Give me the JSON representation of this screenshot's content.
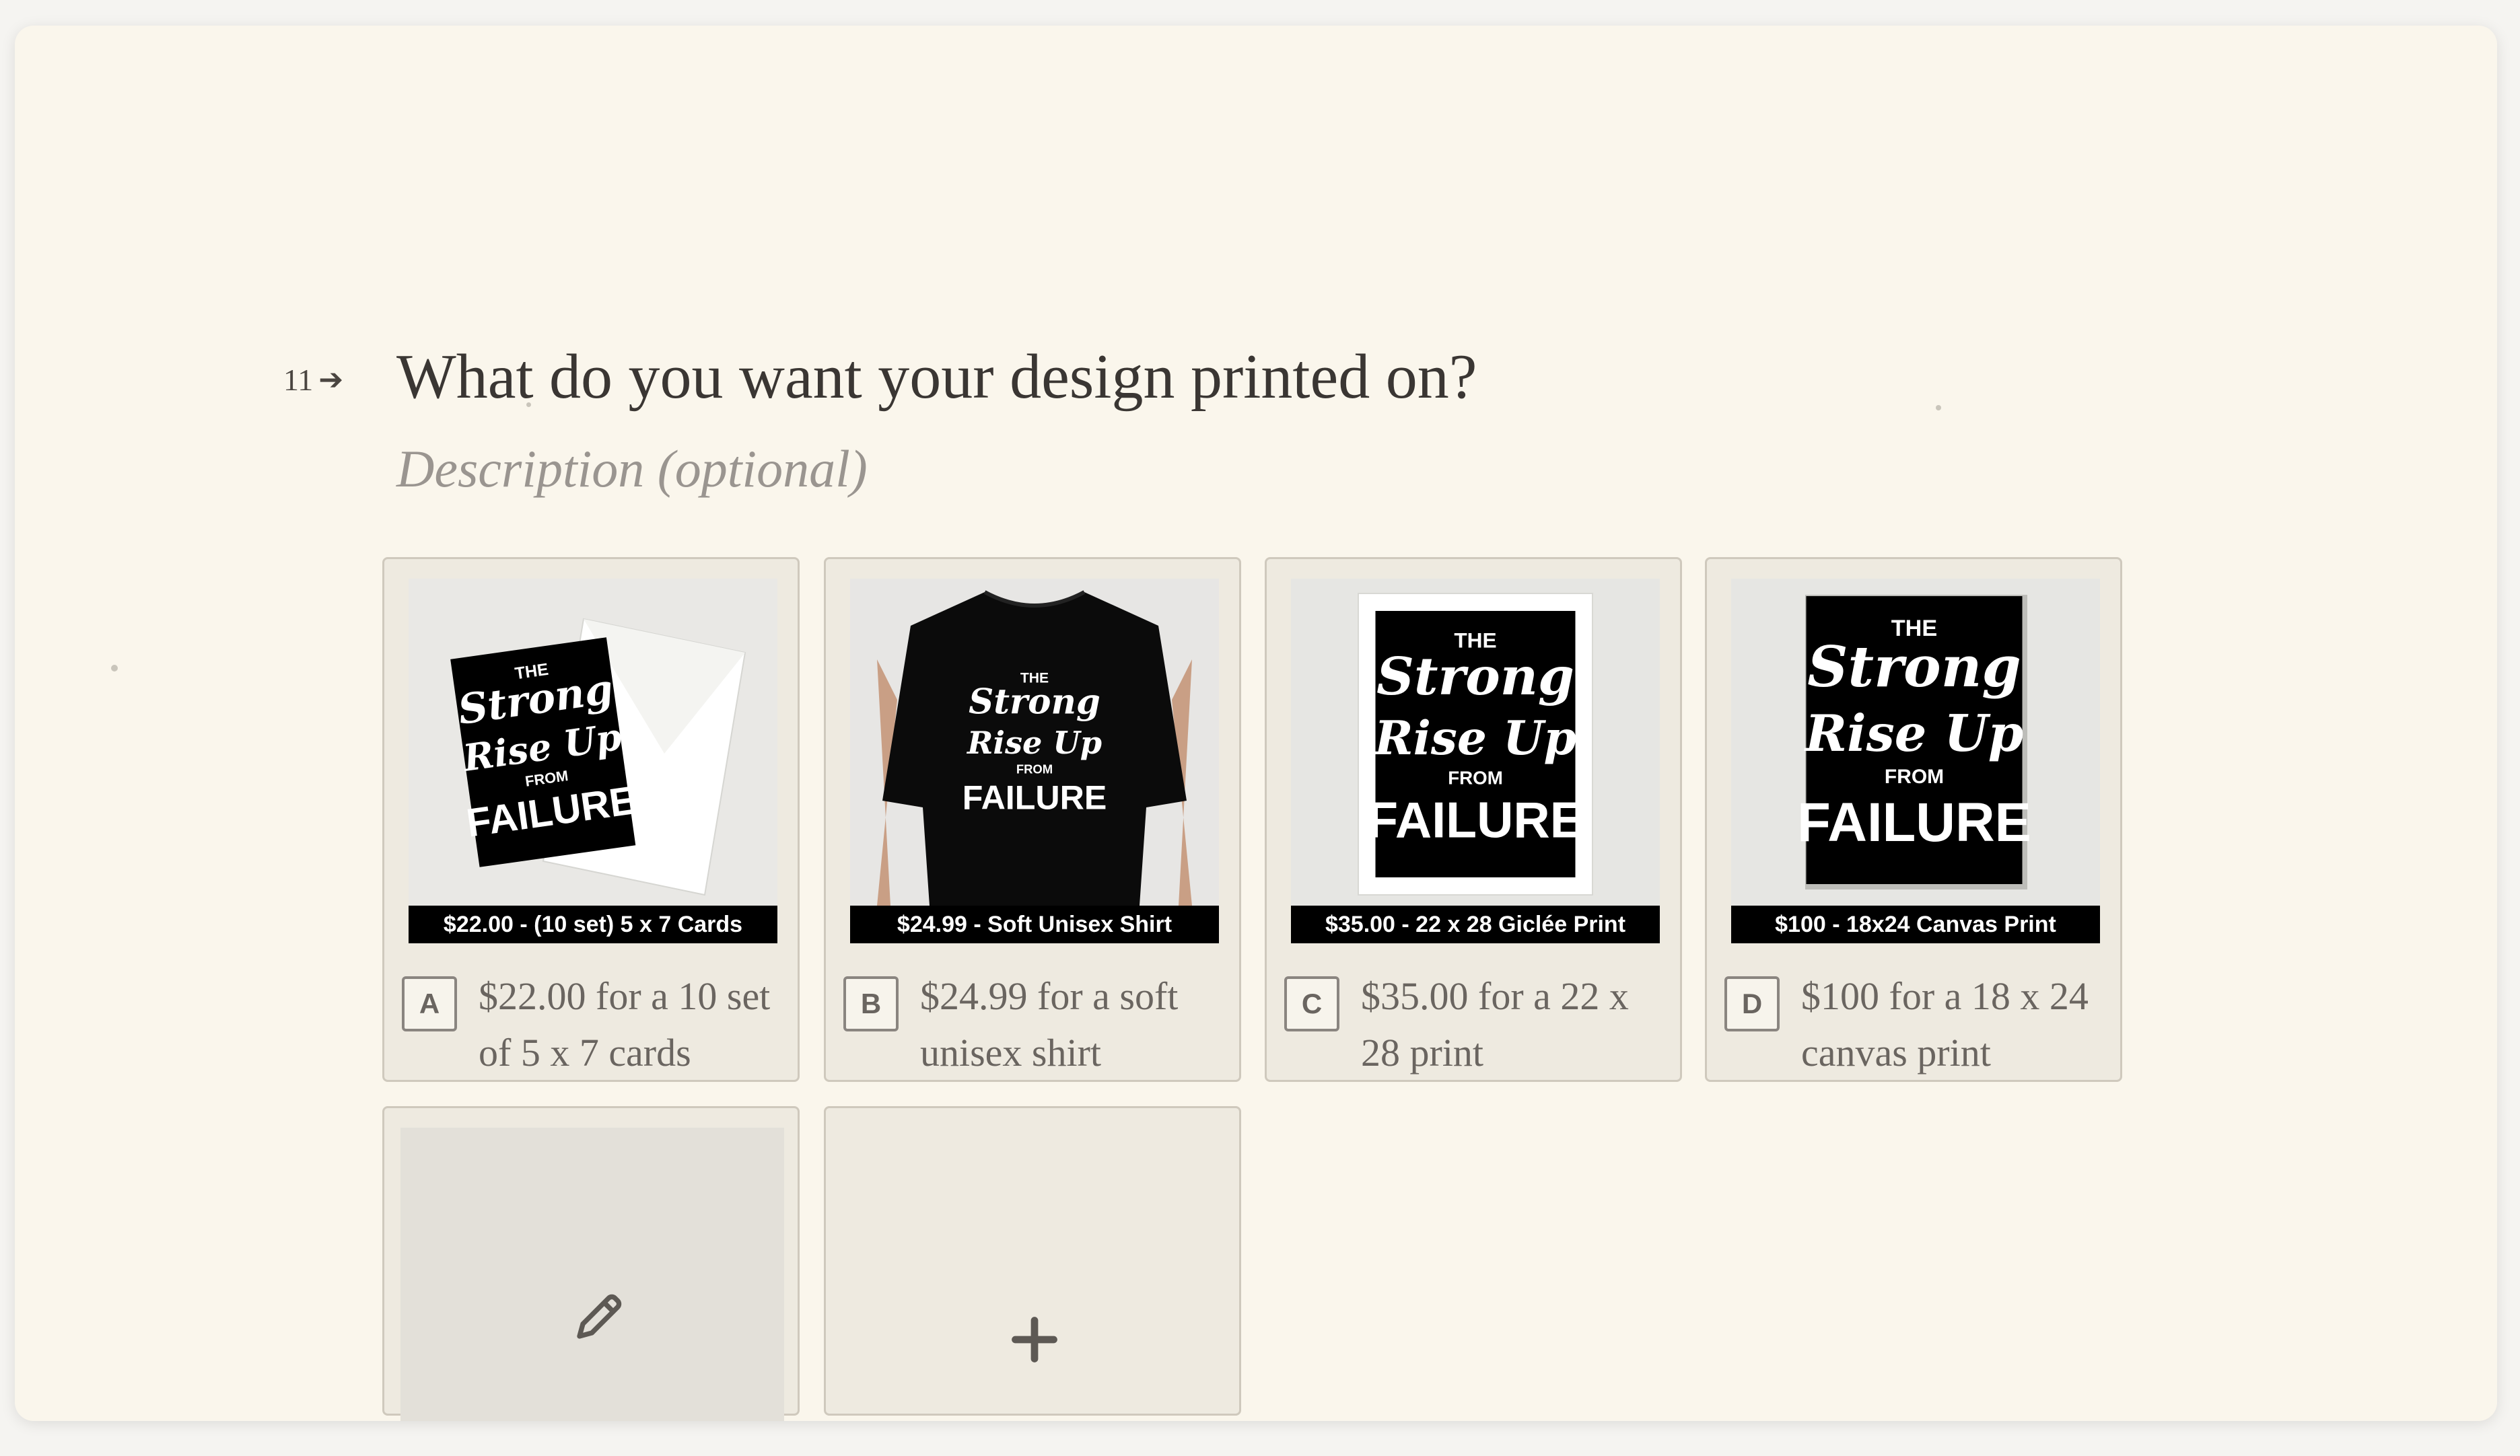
{
  "question": {
    "number": "11",
    "arrow_icon": "arrow-right-icon",
    "title": "What do you want your design printed on?",
    "description_placeholder": "Description (optional)"
  },
  "design": {
    "line1": "THE",
    "line2": "Strong",
    "line3": "Rise Up",
    "line4": "FROM",
    "line5": "FAILURE"
  },
  "choices": [
    {
      "key": "A",
      "label": "$22.00 for a 10 set of 5 x 7 cards",
      "image_caption": "$22.00 - (10 set) 5 x 7 Cards",
      "product": "cards"
    },
    {
      "key": "B",
      "label": "$24.99 for a soft unisex shirt",
      "image_caption": "$24.99 - Soft Unisex Shirt",
      "product": "shirt"
    },
    {
      "key": "C",
      "label": "$35.00 for a 22 x 28 print",
      "image_caption": "$35.00 - 22 x 28 Giclée Print",
      "product": "print"
    },
    {
      "key": "D",
      "label": "$100 for a 18 x 24 canvas print",
      "image_caption": "$100 - 18x24 Canvas Print",
      "product": "canvas"
    }
  ],
  "actions": {
    "edit_icon": "pencil-icon",
    "add_icon": "plus-icon"
  },
  "colors": {
    "background": "#faf6ec",
    "card_background": "#eeeae0",
    "card_border": "#cfc9bd",
    "title_text": "#3a3633",
    "muted_text": "#9a9590"
  }
}
